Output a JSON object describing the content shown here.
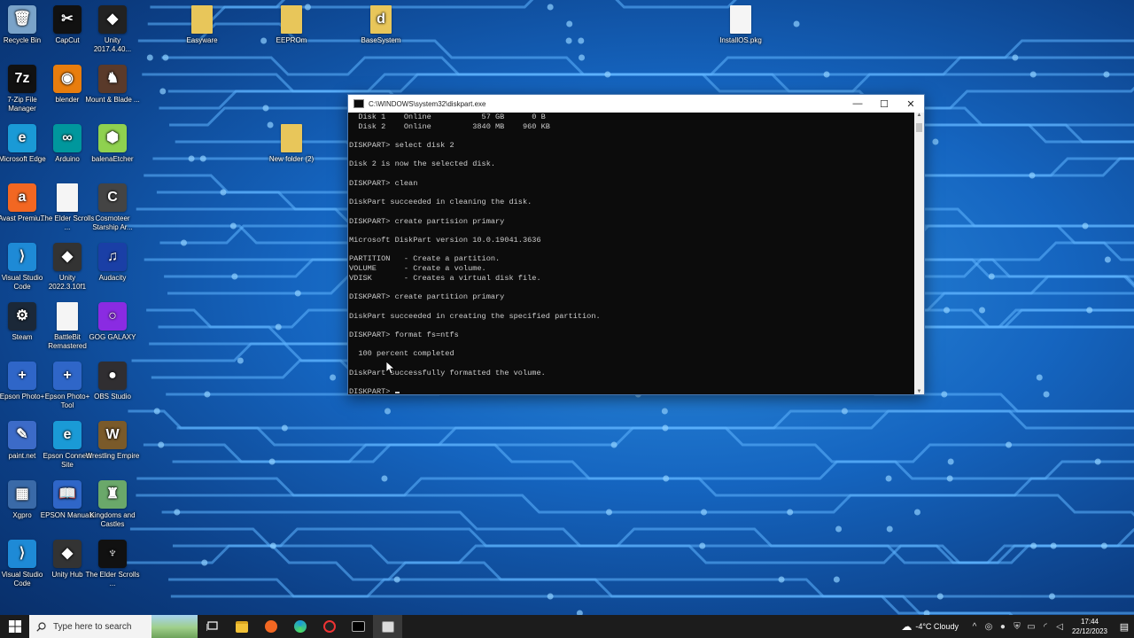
{
  "desktop": {
    "icons": [
      {
        "label": "Recycle Bin",
        "glyph": "🗑",
        "color": "#7aa3c9"
      },
      {
        "label": "CapCut",
        "glyph": "✂",
        "color": "#111111"
      },
      {
        "label": "Unity 2017.4.40...",
        "glyph": "◆",
        "color": "#222222"
      },
      {
        "label": "Easyware",
        "glyph": "",
        "color": "#e8c65a"
      },
      {
        "label": "EEPROm",
        "glyph": "",
        "color": "#e8c65a"
      },
      {
        "label": "BaseSystem",
        "glyph": "d",
        "color": "#e8c65a"
      },
      {
        "label": "InstallOS.pkg",
        "glyph": "",
        "color": "#f5f5f5"
      },
      {
        "label": "7-Zip File Manager",
        "glyph": "7z",
        "color": "#111111"
      },
      {
        "label": "blender",
        "glyph": "◉",
        "color": "#e87d0d"
      },
      {
        "label": "Mount & Blade ...",
        "glyph": "♞",
        "color": "#5a3a2a"
      },
      {
        "label": "Microsoft Edge",
        "glyph": "e",
        "color": "#1a9ad6"
      },
      {
        "label": "Arduino",
        "glyph": "∞",
        "color": "#00979d"
      },
      {
        "label": "balenaEtcher",
        "glyph": "⬢",
        "color": "#8fd14f"
      },
      {
        "label": "New folder (2)",
        "glyph": "",
        "color": "#e8c65a"
      },
      {
        "label": "Avast Premiu...",
        "glyph": "a",
        "color": "#f26722"
      },
      {
        "label": "The Elder Scrolls ...",
        "glyph": "",
        "color": "#f5f5f5"
      },
      {
        "label": "Cosmoteer Starship Ar...",
        "glyph": "C",
        "color": "#444444"
      },
      {
        "label": "Visual Studio Code",
        "glyph": "⟩",
        "color": "#1e8ad6"
      },
      {
        "label": "Unity 2022.3.10f1",
        "glyph": "◆",
        "color": "#333333"
      },
      {
        "label": "Audacity",
        "glyph": "♫",
        "color": "#1a3fa6"
      },
      {
        "label": "Steam",
        "glyph": "⚙",
        "color": "#1b2838"
      },
      {
        "label": "BattleBit Remastered",
        "glyph": "",
        "color": "#f5f5f5"
      },
      {
        "label": "GOG GALAXY",
        "glyph": "○",
        "color": "#8a2be2"
      },
      {
        "label": "Epson Photo+",
        "glyph": "+",
        "color": "#2f66c8"
      },
      {
        "label": "Epson Photo+ Tool",
        "glyph": "+",
        "color": "#2f66c8"
      },
      {
        "label": "OBS Studio",
        "glyph": "●",
        "color": "#302e31"
      },
      {
        "label": "paint.net",
        "glyph": "✎",
        "color": "#3c6bc8"
      },
      {
        "label": "Epson Connect Site",
        "glyph": "e",
        "color": "#1a9ad6"
      },
      {
        "label": "Wrestling Empire",
        "glyph": "W",
        "color": "#7a5a2a"
      },
      {
        "label": "Xgpro",
        "glyph": "▦",
        "color": "#3a6aa8"
      },
      {
        "label": "EPSON Manuals",
        "glyph": "📖",
        "color": "#2f66c8"
      },
      {
        "label": "Kingdoms and Castles",
        "glyph": "♜",
        "color": "#6aa86a"
      },
      {
        "label": "Visual Studio Code",
        "glyph": "⟩",
        "color": "#1e8ad6"
      },
      {
        "label": "Unity Hub",
        "glyph": "◆",
        "color": "#333333"
      },
      {
        "label": "The Elder Scrolls ...",
        "glyph": "♆",
        "color": "#111111"
      }
    ]
  },
  "cmd_window": {
    "title": "C:\\WINDOWS\\system32\\diskpart.exe",
    "minimize": "—",
    "maximize": "☐",
    "close": "✕",
    "lines": [
      "  Disk 1    Online           57 GB      0 B",
      "  Disk 2    Online         3840 MB    960 KB",
      "",
      "DISKPART> select disk 2",
      "",
      "Disk 2 is now the selected disk.",
      "",
      "DISKPART> clean",
      "",
      "DiskPart succeeded in cleaning the disk.",
      "",
      "DISKPART> create partision primary",
      "",
      "Microsoft DiskPart version 10.0.19041.3636",
      "",
      "PARTITION   - Create a partition.",
      "VOLUME      - Create a volume.",
      "VDISK       - Creates a virtual disk file.",
      "",
      "DISKPART> create partition primary",
      "",
      "DiskPart succeeded in creating the specified partition.",
      "",
      "DISKPART> format fs=ntfs",
      "",
      "  100 percent completed",
      "",
      "DiskPart successfully formatted the volume.",
      ""
    ],
    "prompt": "DISKPART> "
  },
  "taskbar": {
    "search_placeholder": "Type here to search",
    "weather": "-4°C  Cloudy",
    "time": "17:44",
    "date": "22/12/2023"
  }
}
